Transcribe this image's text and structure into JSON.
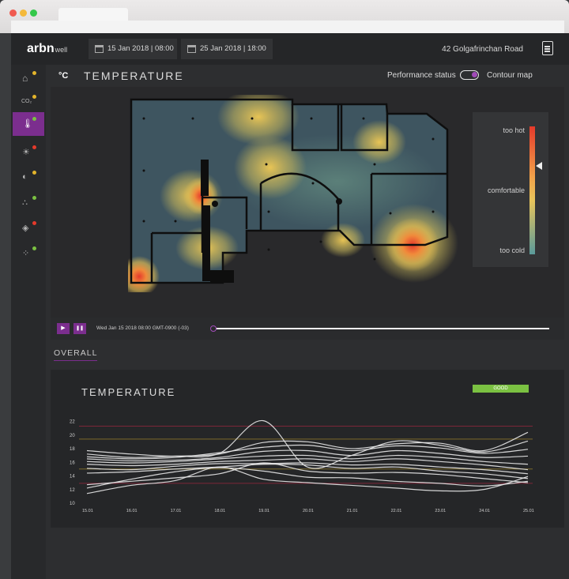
{
  "app": {
    "logo": "arbn",
    "logo_suffix": "well",
    "address": "42 Golgafrinchan Road"
  },
  "dates": {
    "from": "15 Jan 2018 | 08:00",
    "to": "25 Jan 2018 | 18:00"
  },
  "sidebar": {
    "items": [
      {
        "icon": "home-icon",
        "label": ""
      },
      {
        "icon": "co2-icon",
        "label": "CO₂",
        "status": "#e3b42b"
      },
      {
        "icon": "thermometer-icon",
        "label": "",
        "status": "#7bc142",
        "active": true
      },
      {
        "icon": "sun-icon",
        "label": "",
        "status": "#e53a2b"
      },
      {
        "icon": "humidity-icon",
        "label": "",
        "status": "#e3b42b"
      },
      {
        "icon": "particles-icon",
        "label": "",
        "status": "#7bc142"
      },
      {
        "icon": "drop-alert-icon",
        "label": "",
        "status": "#e53a2b"
      },
      {
        "icon": "cells-icon",
        "label": "",
        "status": "#7bc142"
      }
    ]
  },
  "heatmap": {
    "unit": "°C",
    "title": "TEMPERATURE",
    "performance_label": "Performance status",
    "contour_label": "Contour map",
    "legend": {
      "hot": "too hot",
      "mid": "comfortable",
      "cold": "too cold"
    }
  },
  "player": {
    "play": "▶",
    "pause": "❚❚",
    "timestamp": "Wed Jan 15 2018 08:00 GMT-0900 (-03)",
    "progress": 0.0
  },
  "overall_label": "OVERALL",
  "colors": {
    "accent": "#7b2e8e",
    "good": "#7bc142"
  },
  "chart_data": {
    "type": "line",
    "title": "TEMPERATURE",
    "status": "GOOD",
    "ylim": [
      10,
      23
    ],
    "yticks": [
      10,
      12,
      14,
      16,
      18,
      20,
      22
    ],
    "categories": [
      "15.01",
      "16.01",
      "17.01",
      "18.01",
      "19.01",
      "20.01",
      "21.01",
      "22.01",
      "23.01",
      "24.01",
      "25.01"
    ],
    "thresholds": [
      {
        "value": 21.2,
        "color": "#7d2638"
      },
      {
        "value": 19.3,
        "color": "#7c6a2a"
      },
      {
        "value": 14.9,
        "color": "#7c6a2a"
      },
      {
        "value": 12.8,
        "color": "#7d2638"
      }
    ],
    "series": [
      {
        "values": [
          17.6,
          17.1,
          16.8,
          17.2,
          22.0,
          15.2,
          16.9,
          19.0,
          18.4,
          17.4,
          19.0
        ]
      },
      {
        "values": [
          17.1,
          16.6,
          16.8,
          17.1,
          18.8,
          18.9,
          17.9,
          18.6,
          18.7,
          17.6,
          20.3
        ]
      },
      {
        "values": [
          16.7,
          16.4,
          16.6,
          17.3,
          18.1,
          18.4,
          17.6,
          18.3,
          18.0,
          17.2,
          17.8
        ]
      },
      {
        "values": [
          16.4,
          16.1,
          16.2,
          16.6,
          17.5,
          17.6,
          16.9,
          17.6,
          17.2,
          16.6,
          16.8
        ]
      },
      {
        "values": [
          16.0,
          15.8,
          16.0,
          16.4,
          16.8,
          16.9,
          16.4,
          16.9,
          16.6,
          16.0,
          15.6
        ]
      },
      {
        "values": [
          15.6,
          15.4,
          15.6,
          16.0,
          16.2,
          16.4,
          16.0,
          16.4,
          16.0,
          15.5,
          14.8
        ]
      },
      {
        "values": [
          15.0,
          14.8,
          15.3,
          15.7,
          15.7,
          15.8,
          15.5,
          15.6,
          15.2,
          14.8,
          14.2
        ]
      },
      {
        "values": [
          14.3,
          14.5,
          14.9,
          15.2,
          15.6,
          15.5,
          15.0,
          15.2,
          14.6,
          14.2,
          13.5
        ]
      },
      {
        "values": [
          12.6,
          13.1,
          13.6,
          14.2,
          15.8,
          14.6,
          14.3,
          14.4,
          14.1,
          13.5,
          12.9
        ]
      },
      {
        "values": [
          12.1,
          13.4,
          14.5,
          15.1,
          14.6,
          13.7,
          13.6,
          13.1,
          12.8,
          12.4,
          13.1
        ]
      },
      {
        "values": [
          11.3,
          12.5,
          13.2,
          15.2,
          13.4,
          12.9,
          12.5,
          12.1,
          11.7,
          11.9,
          13.8
        ]
      }
    ]
  }
}
